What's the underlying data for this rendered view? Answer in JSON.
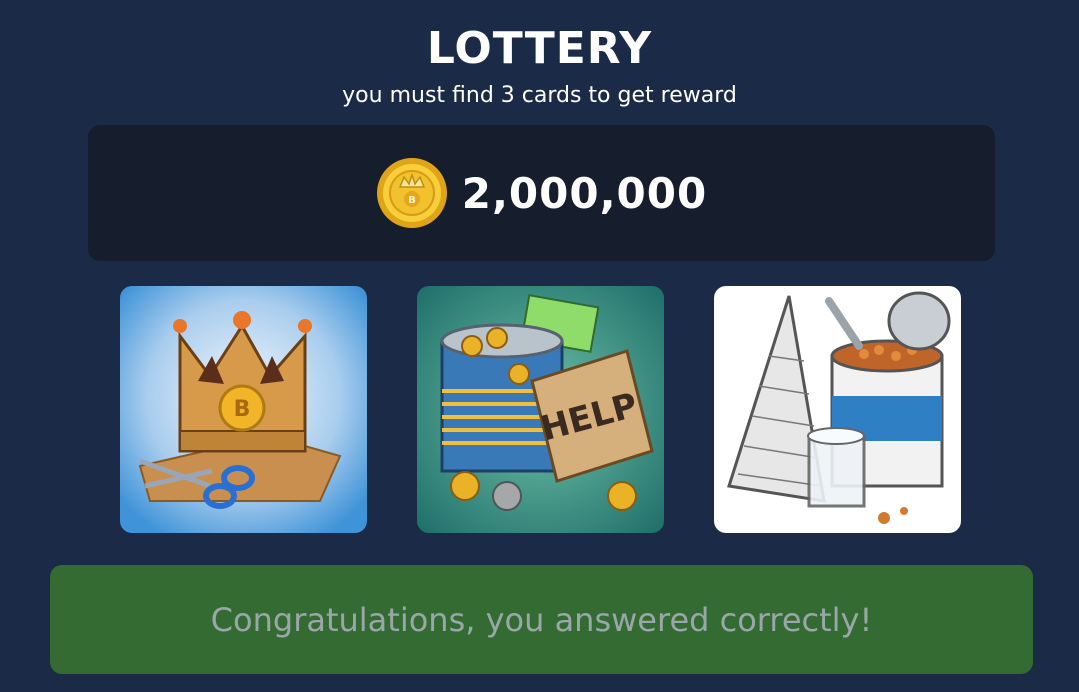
{
  "header": {
    "title": "LOTTERY",
    "subtitle": "you must find 3 cards to get reward"
  },
  "reward": {
    "icon": "gold-coin-icon",
    "amount": "2,000,000"
  },
  "cards": [
    {
      "name": "card-crown",
      "icon": "paper-crown-scissors-icon"
    },
    {
      "name": "card-help-can",
      "icon": "tin-can-help-sign-icon"
    },
    {
      "name": "card-paper-cone",
      "icon": "paper-cone-beans-can-icon"
    }
  ],
  "result": {
    "message": "Congratulations, you answered correctly!"
  },
  "colors": {
    "background": "#1b2a47",
    "panel": "#161d2d",
    "success": "#346b33",
    "success_text": "#9aa7a8",
    "coin": "#f2c12e"
  }
}
